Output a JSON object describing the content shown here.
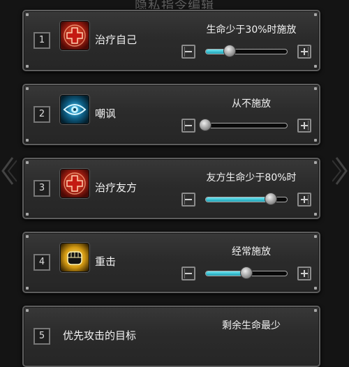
{
  "header": {
    "title": "隐私指令编辑"
  },
  "colors": {
    "fill_accent": "#2fc4d6",
    "heal_icon_bg": "#8a1a10",
    "eye_icon_bg": "#0e4a66",
    "fist_icon_bg": "#2a2a2a"
  },
  "skills": [
    {
      "number": "1",
      "name": "治疗自己",
      "icon": "red-cross-icon",
      "condition": "生命少于30%时施放",
      "level": 0.3
    },
    {
      "number": "2",
      "name": "嘲讽",
      "icon": "eye-icon",
      "condition": "从不施放",
      "level": 0.0
    },
    {
      "number": "3",
      "name": "治疗友方",
      "icon": "red-cross-icon",
      "condition": "友方生命少于80%时",
      "level": 0.8
    },
    {
      "number": "4",
      "name": "重击",
      "icon": "fist-icon",
      "condition": "经常施放",
      "level": 0.5
    },
    {
      "number": "5",
      "name": "优先攻击的目标",
      "condition": "剩余生命最少"
    }
  ]
}
